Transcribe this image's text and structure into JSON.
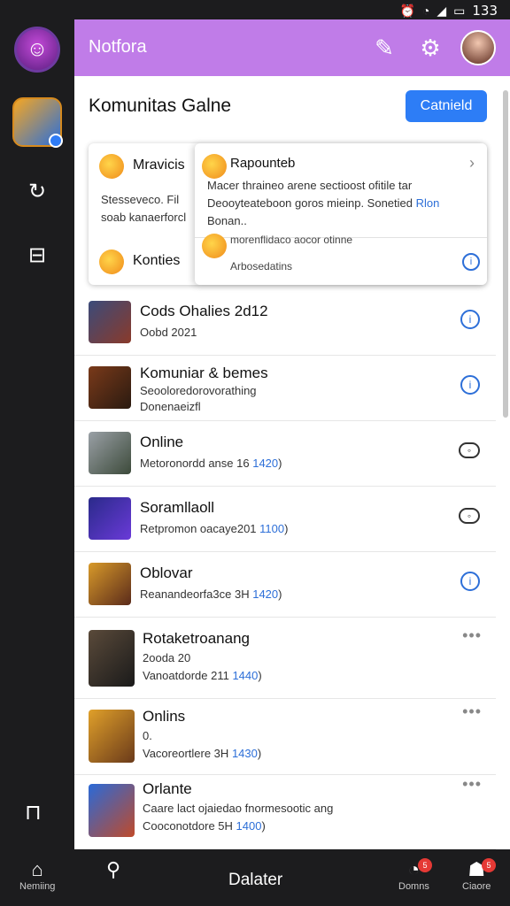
{
  "status_bar": {
    "time": "133",
    "icons": [
      "alarm-icon",
      "wifi-icon",
      "signal-icon",
      "battery-icon"
    ]
  },
  "topbar": {
    "title": "Notfora",
    "color": "#c07ce8"
  },
  "header": {
    "title": "Komunitas Galne",
    "button_label": "Catnield",
    "button_color": "#2d7df6"
  },
  "notification_card": {
    "left_title": "Mravicis",
    "left_body": "Stesseveco. Fil soab kanaerforcl",
    "left_second_title": "Konties",
    "popover": {
      "title": "Rapounteb",
      "body": "Macer thraineo arene sectioost ofitile tar Deooyteateboon goros mieinp. Sonetied",
      "link": "Rlon",
      "body_end": "Bonan..",
      "sub1": "morenflidaco aocor otinne",
      "sub2": "Arbosedatins"
    }
  },
  "list": [
    {
      "title": "Cods Ohalies 2d12",
      "sub": "Oobd 2021",
      "sub2": "",
      "action": "info"
    },
    {
      "title": "Komuniar & bemes",
      "sub": "Seooloredorovorathing",
      "sub2": "Donenaeizfl",
      "action": "info"
    },
    {
      "title": "Online",
      "sub": "Metoronordd anse 16",
      "num": "1420",
      "action": "toggle"
    },
    {
      "title": "Soramllaoll",
      "sub": "Retpromon oacaye201",
      "num": "1100",
      "action": "toggle"
    },
    {
      "title": "Oblovar",
      "sub": "Reanandeorfa3ce 3H",
      "num": "1420",
      "action": "info"
    },
    {
      "title": "Rotaketroanang",
      "sub": "2ooda 20",
      "sub2": "Vanoatdorde 211",
      "num": "1440",
      "action": "more"
    },
    {
      "title": "Onlins",
      "sub": "0.",
      "sub2": "Vacoreortlere 3H",
      "num": "1430",
      "action": "more"
    },
    {
      "title": "Orlante",
      "sub": "Caare lact ojaiedao fnormesootic ang",
      "sub2": "Cooconotdore 5H",
      "num": "1400",
      "action": "more"
    }
  ],
  "bottom_nav": {
    "home_label": "Nemiing",
    "center_label": "Dalater",
    "right1_label": "Domns",
    "right2_label": "Ciaore",
    "badge1": "5",
    "badge2": "5"
  }
}
